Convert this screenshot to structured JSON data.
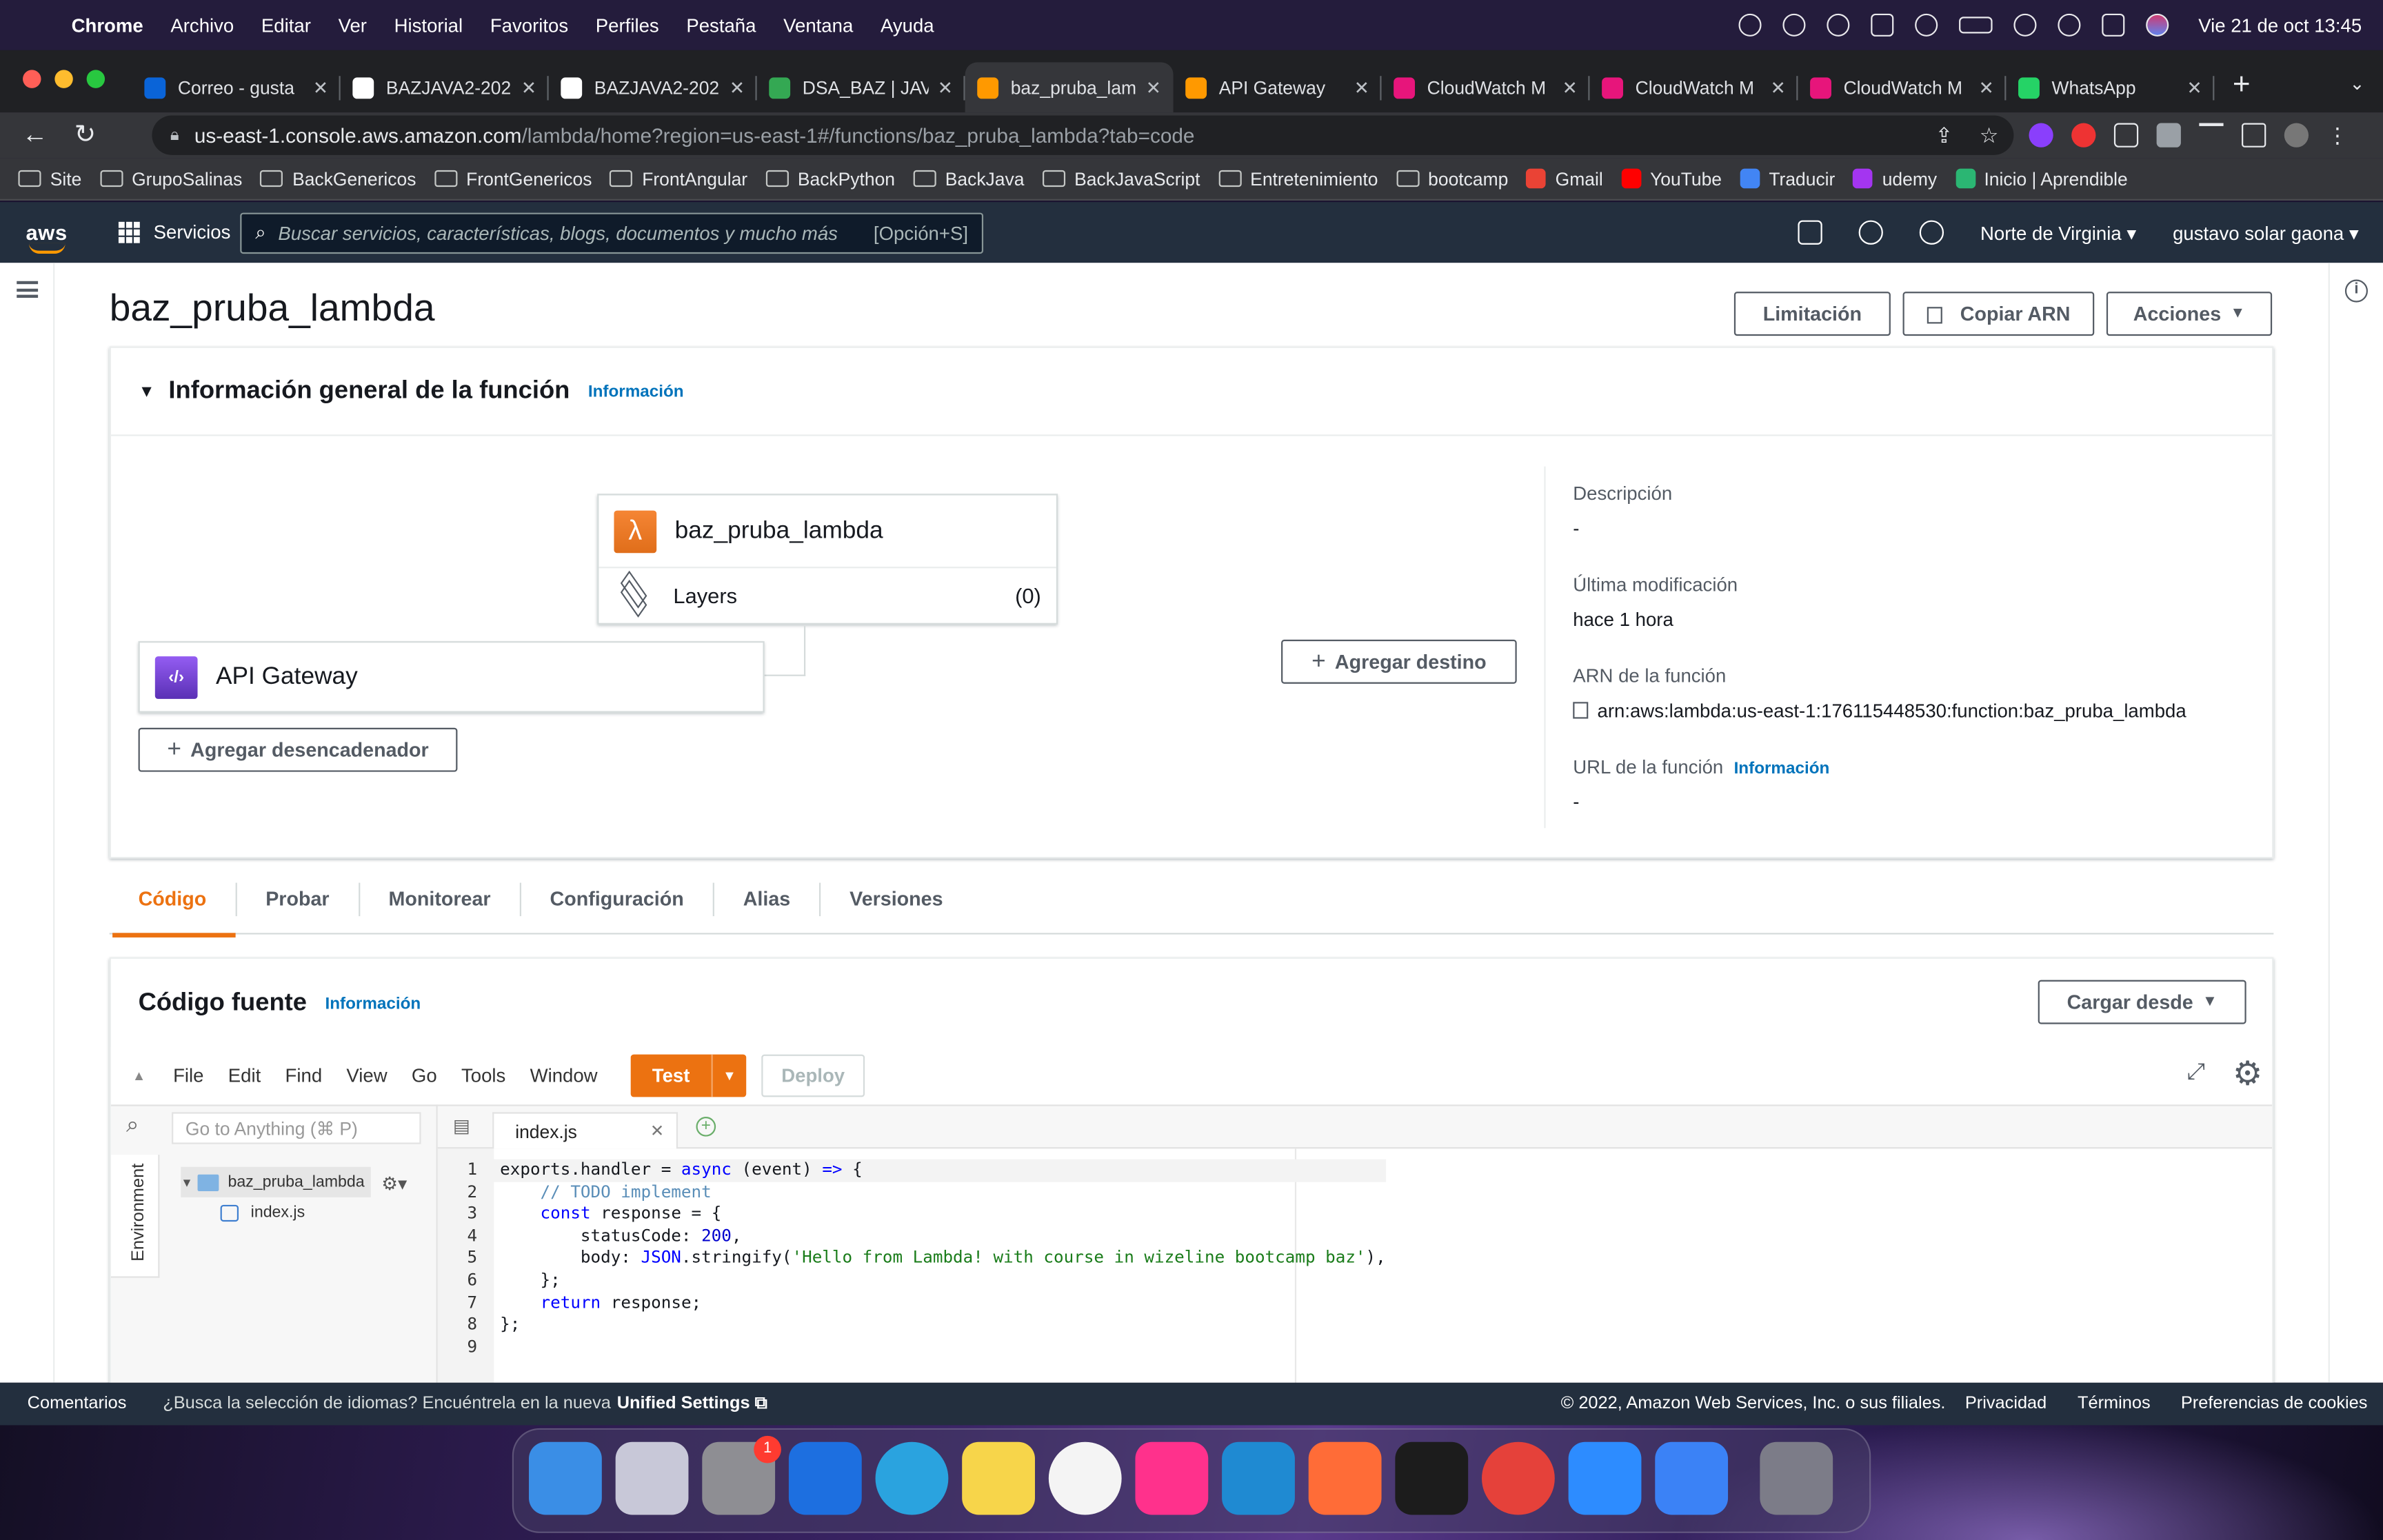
{
  "menubar": {
    "apple": "",
    "items": [
      "Chrome",
      "Archivo",
      "Editar",
      "Ver",
      "Historial",
      "Favoritos",
      "Perfiles",
      "Pestaña",
      "Ventana",
      "Ayuda"
    ],
    "clock": "Vie 21 de oct  13:45"
  },
  "browser": {
    "tabs": [
      {
        "title": "Correo - gusta",
        "fav": "#0a64d8"
      },
      {
        "title": "BAZJAVA2-202",
        "fav": "#ffffff"
      },
      {
        "title": "BAZJAVA2-202",
        "fav": "#ffffff"
      },
      {
        "title": "DSA_BAZ | JAV",
        "fav": "#34a853"
      },
      {
        "title": "baz_pruba_lam",
        "fav": "#ff9900"
      },
      {
        "title": "API Gateway",
        "fav": "#ff9900"
      },
      {
        "title": "CloudWatch M",
        "fav": "#e7157b"
      },
      {
        "title": "CloudWatch M",
        "fav": "#e7157b"
      },
      {
        "title": "CloudWatch M",
        "fav": "#e7157b"
      },
      {
        "title": "WhatsApp",
        "fav": "#25d366"
      }
    ],
    "url_host": "us-east-1.console.aws.amazon.com",
    "url_path": "/lambda/home?region=us-east-1#/functions/baz_pruba_lambda?tab=code",
    "bookmarks": [
      {
        "label": "Site",
        "type": "folder"
      },
      {
        "label": "GrupoSalinas",
        "type": "folder"
      },
      {
        "label": "BackGenericos",
        "type": "folder"
      },
      {
        "label": "FrontGenericos",
        "type": "folder"
      },
      {
        "label": "FrontAngular",
        "type": "folder"
      },
      {
        "label": "BackPython",
        "type": "folder"
      },
      {
        "label": "BackJava",
        "type": "folder"
      },
      {
        "label": "BackJavaScript",
        "type": "folder"
      },
      {
        "label": "Entretenimiento",
        "type": "folder"
      },
      {
        "label": "bootcamp",
        "type": "folder"
      },
      {
        "label": "Gmail",
        "type": "site",
        "color": "#ea4335"
      },
      {
        "label": "YouTube",
        "type": "site",
        "color": "#ff0000"
      },
      {
        "label": "Traducir",
        "type": "site",
        "color": "#4285f4"
      },
      {
        "label": "udemy",
        "type": "site",
        "color": "#a435f0"
      },
      {
        "label": "Inicio | Aprendible",
        "type": "site",
        "color": "#2bb673"
      }
    ]
  },
  "aws": {
    "logo": "aws",
    "services": "Servicios",
    "search_placeholder": "Buscar servicios, características, blogs, documentos y mucho más",
    "search_shortcut": "[Opción+S]",
    "region": "Norte de Virginia",
    "user": "gustavo solar gaona"
  },
  "function": {
    "name": "baz_pruba_lambda",
    "buttons": {
      "throttle": "Limitación",
      "copy_arn": "Copiar ARN",
      "actions": "Acciones"
    },
    "overview_title": "Información general de la función",
    "info_link": "Información",
    "layers_label": "Layers",
    "layers_count": "(0)",
    "trigger": "API Gateway",
    "add_trigger": "Agregar desencadenador",
    "add_destination": "Agregar destino",
    "description_label": "Descripción",
    "description_value": "-",
    "modified_label": "Última modificación",
    "modified_value": "hace 1 hora",
    "arn_label": "ARN de la función",
    "arn_value": "arn:aws:lambda:us-east-1:176115448530:function:baz_pruba_lambda",
    "url_label": "URL de la función",
    "url_value": "-"
  },
  "tabs": [
    "Código",
    "Probar",
    "Monitorear",
    "Configuración",
    "Alias",
    "Versiones"
  ],
  "code_source": {
    "title": "Código fuente",
    "info": "Información",
    "upload": "Cargar desde",
    "menu": [
      "File",
      "Edit",
      "Find",
      "View",
      "Go",
      "Tools",
      "Window"
    ],
    "test": "Test",
    "deploy": "Deploy",
    "goto_placeholder": "Go to Anything (⌘ P)",
    "env_label": "Environment",
    "folder": "baz_pruba_lambda",
    "file": "index.js",
    "open_tab": "index.js"
  },
  "code_lines": [
    "exports.handler = async (event) => {",
    "    // TODO implement",
    "    const response = {",
    "        statusCode: 200,",
    "        body: JSON.stringify('Hello from Lambda! with course in wizeline bootcamp baz'),",
    "    };",
    "    return response;",
    "};",
    ""
  ],
  "footer": {
    "feedback": "Comentarios",
    "lang_note": "¿Busca la selección de idiomas? Encuéntrela en la nueva",
    "unified": "Unified Settings",
    "copyright": "© 2022, Amazon Web Services, Inc. o sus filiales.",
    "privacy": "Privacidad",
    "terms": "Términos",
    "cookies": "Preferencias de cookies"
  },
  "dock": [
    {
      "name": "finder-icon",
      "color": "#3a8ee6"
    },
    {
      "name": "launchpad-icon",
      "color": "#c8c8d8"
    },
    {
      "name": "system-preferences-icon",
      "color": "#8e8e93",
      "badge": "1"
    },
    {
      "name": "xcode-icon",
      "color": "#1d6fe0"
    },
    {
      "name": "telegram-icon",
      "color": "#2aa3df"
    },
    {
      "name": "notes-icon",
      "color": "#f7d54a"
    },
    {
      "name": "mongodb-compass-icon",
      "color": "#f4f4f4"
    },
    {
      "name": "intellij-icon",
      "color": "#ff318c"
    },
    {
      "name": "vscode-icon",
      "color": "#1f8ad2"
    },
    {
      "name": "postman-icon",
      "color": "#ff6c37"
    },
    {
      "name": "terminal-icon",
      "color": "#1c1c1c"
    },
    {
      "name": "chrome-icon",
      "color": "#e5413a"
    },
    {
      "name": "zoom-icon",
      "color": "#2d8cff"
    },
    {
      "name": "todo-app-icon",
      "color": "#3b82f6"
    },
    {
      "name": "trash-icon",
      "color": "#7c7c88"
    }
  ]
}
